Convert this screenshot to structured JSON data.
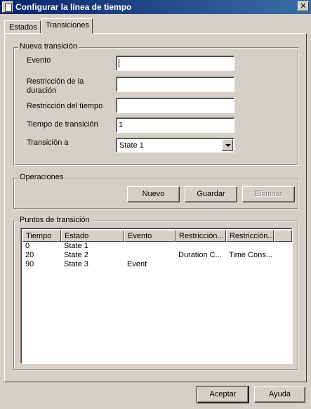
{
  "window": {
    "title": "Configurar la línea de tiempo",
    "close_glyph": "✕"
  },
  "tabs": [
    {
      "label": "Estados",
      "selected": false
    },
    {
      "label": "Transiciones",
      "selected": true
    }
  ],
  "nueva_transicion": {
    "legend": "Nueva transición",
    "evento_label": "Evento",
    "evento_value": "",
    "restriccion_duracion_label": "Restricción de la duración",
    "restriccion_duracion_value": "",
    "restriccion_tiempo_label": "Restricción del tiempo",
    "restriccion_tiempo_value": "",
    "tiempo_transicion_label": "Tiempo de transición",
    "tiempo_transicion_value": "1",
    "transicion_a_label": "Transición a",
    "transicion_a_value": "State 1"
  },
  "operaciones": {
    "legend": "Operaciones",
    "nuevo": "Nuevo",
    "guardar": "Guardar",
    "eliminar": "Eliminar"
  },
  "puntos": {
    "legend": "Puntos de transición",
    "columns": [
      "Tiempo",
      "Estado",
      "Evento",
      "Restricción...",
      "Restricción..."
    ],
    "rows": [
      [
        "0",
        "State 1",
        "",
        "",
        ""
      ],
      [
        "20",
        "State 2",
        "",
        "Duration C...",
        "Time Cons..."
      ],
      [
        "90",
        "State 3",
        "Event",
        "",
        ""
      ]
    ]
  },
  "footer": {
    "aceptar": "Aceptar",
    "ayuda": "Ayuda"
  },
  "colors": {
    "titlebar_start": "#0a246a",
    "titlebar_end": "#3a6ea5",
    "face": "#d4d0c8"
  }
}
